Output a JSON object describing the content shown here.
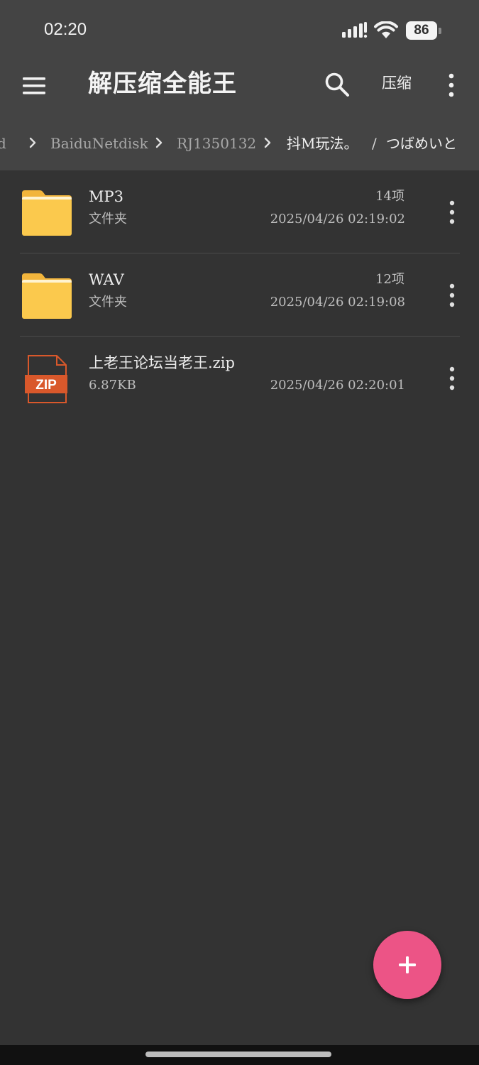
{
  "status_bar": {
    "time": "02:20",
    "battery": "86",
    "icons": [
      "signal-icon",
      "wifi-icon",
      "battery-icon"
    ]
  },
  "toolbar": {
    "title": "解压缩全能王",
    "compress_label": "压缩",
    "icons": [
      "menu-icon",
      "search-icon",
      "overflow-menu-icon"
    ]
  },
  "breadcrumb": {
    "items": [
      {
        "label": "d"
      },
      {
        "label": "BaiduNetdisk"
      },
      {
        "label": "RJ1350132"
      },
      {
        "label": "抖M玩法。"
      },
      {
        "label": "つばめいと"
      }
    ],
    "separator": "/"
  },
  "files": [
    {
      "name": "MP3",
      "type": "文件夹",
      "count": "14项",
      "date": "2025/04/26  02:19:02",
      "icon": "folder-icon"
    },
    {
      "name": "WAV",
      "type": "文件夹",
      "count": "12项",
      "date": "2025/04/26  02:19:08",
      "icon": "folder-icon"
    },
    {
      "name": "上老王论坛当老王.zip",
      "size": "6.87KB",
      "date": "2025/04/26  02:20:01",
      "icon": "zip-file-icon",
      "badge": "ZIP"
    }
  ],
  "colors": {
    "header_bg": "#444444",
    "list_bg": "#333333",
    "fab": "#ec5486",
    "folder": "#fbc94d",
    "zip": "#d9582b"
  }
}
